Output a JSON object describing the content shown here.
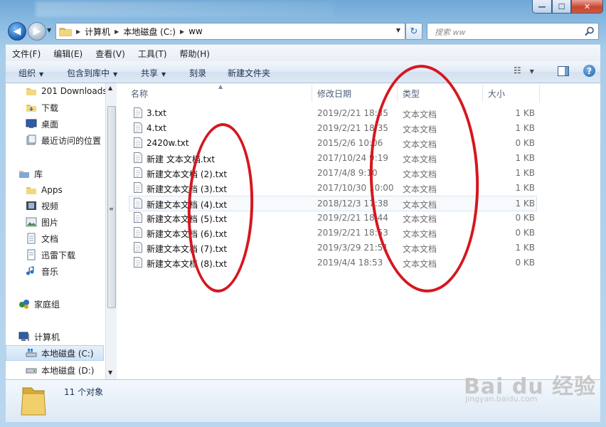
{
  "window": {
    "caption_min": "—",
    "caption_max": "☐",
    "caption_close": "✕"
  },
  "address": {
    "back_glyph": "◀",
    "forward_glyph": "▶",
    "crumbs": [
      "计算机",
      "本地磁盘 (C:)",
      "ww"
    ],
    "refresh_glyph": "↻",
    "search_placeholder": "搜索 ww"
  },
  "menubar": [
    "文件(F)",
    "编辑(E)",
    "查看(V)",
    "工具(T)",
    "帮助(H)"
  ],
  "toolbar": {
    "organize": "组织",
    "include_in_library": "包含到库中",
    "share": "共享",
    "burn": "刻录",
    "new_folder": "新建文件夹",
    "help": "?"
  },
  "navpane": {
    "favorites": [
      {
        "label": "201 Downloads",
        "icon": "folder-icon"
      },
      {
        "label": "下载",
        "icon": "downloads-folder-icon"
      },
      {
        "label": "桌面",
        "icon": "desktop-icon"
      },
      {
        "label": "最近访问的位置",
        "icon": "recent-places-icon"
      }
    ],
    "libraries_label": "库",
    "libraries": [
      {
        "label": "Apps",
        "icon": "folder-icon"
      },
      {
        "label": "视频",
        "icon": "video-icon"
      },
      {
        "label": "图片",
        "icon": "pictures-icon"
      },
      {
        "label": "文档",
        "icon": "documents-icon"
      },
      {
        "label": "迅雷下载",
        "icon": "thunder-download-icon"
      },
      {
        "label": "音乐",
        "icon": "music-icon"
      }
    ],
    "homegroup_label": "家庭组",
    "computer_label": "计算机",
    "drives": [
      {
        "label": "本地磁盘 (C:)",
        "selected": true
      },
      {
        "label": "本地磁盘 (D:)",
        "selected": false
      }
    ]
  },
  "columns": {
    "name": "名称",
    "modified": "修改日期",
    "type": "类型",
    "size": "大小"
  },
  "files": [
    {
      "name": "3.txt",
      "modified": "2019/2/21 18:35",
      "type": "文本文档",
      "size": "1 KB"
    },
    {
      "name": "4.txt",
      "modified": "2019/2/21 18:35",
      "type": "文本文档",
      "size": "1 KB"
    },
    {
      "name": "2420w.txt",
      "modified": "2015/2/6 10:06",
      "type": "文本文档",
      "size": "0 KB"
    },
    {
      "name": "新建 文本文档.txt",
      "modified": "2017/10/24 9:19",
      "type": "文本文档",
      "size": "1 KB"
    },
    {
      "name": "新建文本文档 (2).txt",
      "modified": "2017/4/8 9:10",
      "type": "文本文档",
      "size": "1 KB"
    },
    {
      "name": "新建文本文档 (3).txt",
      "modified": "2017/10/30 10:00",
      "type": "文本文档",
      "size": "1 KB"
    },
    {
      "name": "新建文本文档 (4).txt",
      "modified": "2018/12/3 17:38",
      "type": "文本文档",
      "size": "1 KB"
    },
    {
      "name": "新建文本文档 (5).txt",
      "modified": "2019/2/21 18:44",
      "type": "文本文档",
      "size": "0 KB"
    },
    {
      "name": "新建文本文档 (6).txt",
      "modified": "2019/2/21 18:53",
      "type": "文本文档",
      "size": "0 KB"
    },
    {
      "name": "新建文本文档 (7).txt",
      "modified": "2019/3/29 21:51",
      "type": "文本文档",
      "size": "1 KB"
    },
    {
      "name": "新建文本文档 (8).txt",
      "modified": "2019/4/4 18:53",
      "type": "文本文档",
      "size": "0 KB"
    }
  ],
  "status": {
    "item_count": "11 个对象"
  },
  "watermark": {
    "brand": "Bai du 经验",
    "url": "jingyan.baidu.com"
  },
  "colors": {
    "annotation_red": "#d5171f",
    "window_glass": "#a9cdea"
  }
}
